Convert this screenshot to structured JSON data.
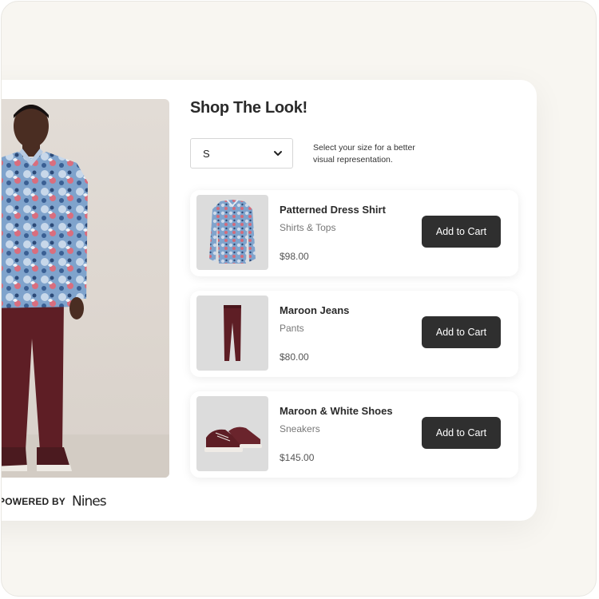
{
  "widget": {
    "title": "Shop The Look!",
    "size_select": {
      "value": "S",
      "icon": "chevron-down-icon"
    },
    "size_hint": "Select your size for a better visual representation.",
    "products": [
      {
        "name": "Patterned Dress Shirt",
        "category": "Shirts & Tops",
        "price": "$98.00",
        "button": "Add to Cart"
      },
      {
        "name": "Maroon Jeans",
        "category": "Pants",
        "price": "$80.00",
        "button": "Add to Cart"
      },
      {
        "name": "Maroon & White Shoes",
        "category": "Sneakers",
        "price": "$145.00",
        "button": "Add to Cart"
      }
    ],
    "powered_by": "POWERED BY",
    "brand": "Nines"
  },
  "colors": {
    "button_bg": "#2f2f2f",
    "background": "#f8f6f1",
    "maroon": "#5e1e25",
    "shirt_blue": "#6f95c2"
  }
}
